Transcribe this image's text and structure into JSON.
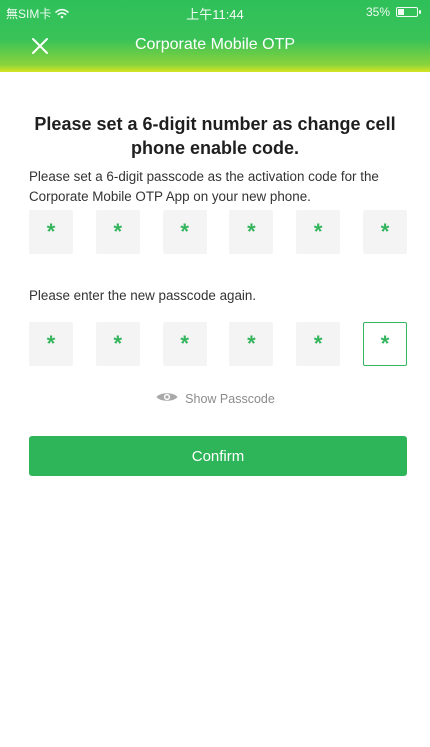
{
  "status_bar": {
    "carrier": "無SIM卡",
    "time": "上午11:44",
    "battery": "35%",
    "battery_level": 0.35
  },
  "nav": {
    "title": "Corporate Mobile OTP"
  },
  "main": {
    "title": "Please set a 6-digit number as change cell phone enable code.",
    "description": "Please set a 6-digit passcode as the activation code for the Corporate Mobile OTP App on your new phone.",
    "first_passcode": [
      "*",
      "*",
      "*",
      "*",
      "*",
      "*"
    ],
    "reenter_prompt": "Please enter the new passcode again.",
    "second_passcode": [
      "*",
      "*",
      "*",
      "*",
      "*",
      "*"
    ],
    "show_passcode_label": "Show Passcode",
    "confirm_label": "Confirm"
  },
  "colors": {
    "brand_green": "#2fb559",
    "otp_star": "#34b55c"
  },
  "icons": {
    "close": "close-icon",
    "eye": "eye-icon",
    "wifi": "wifi-icon",
    "battery": "battery-icon"
  }
}
